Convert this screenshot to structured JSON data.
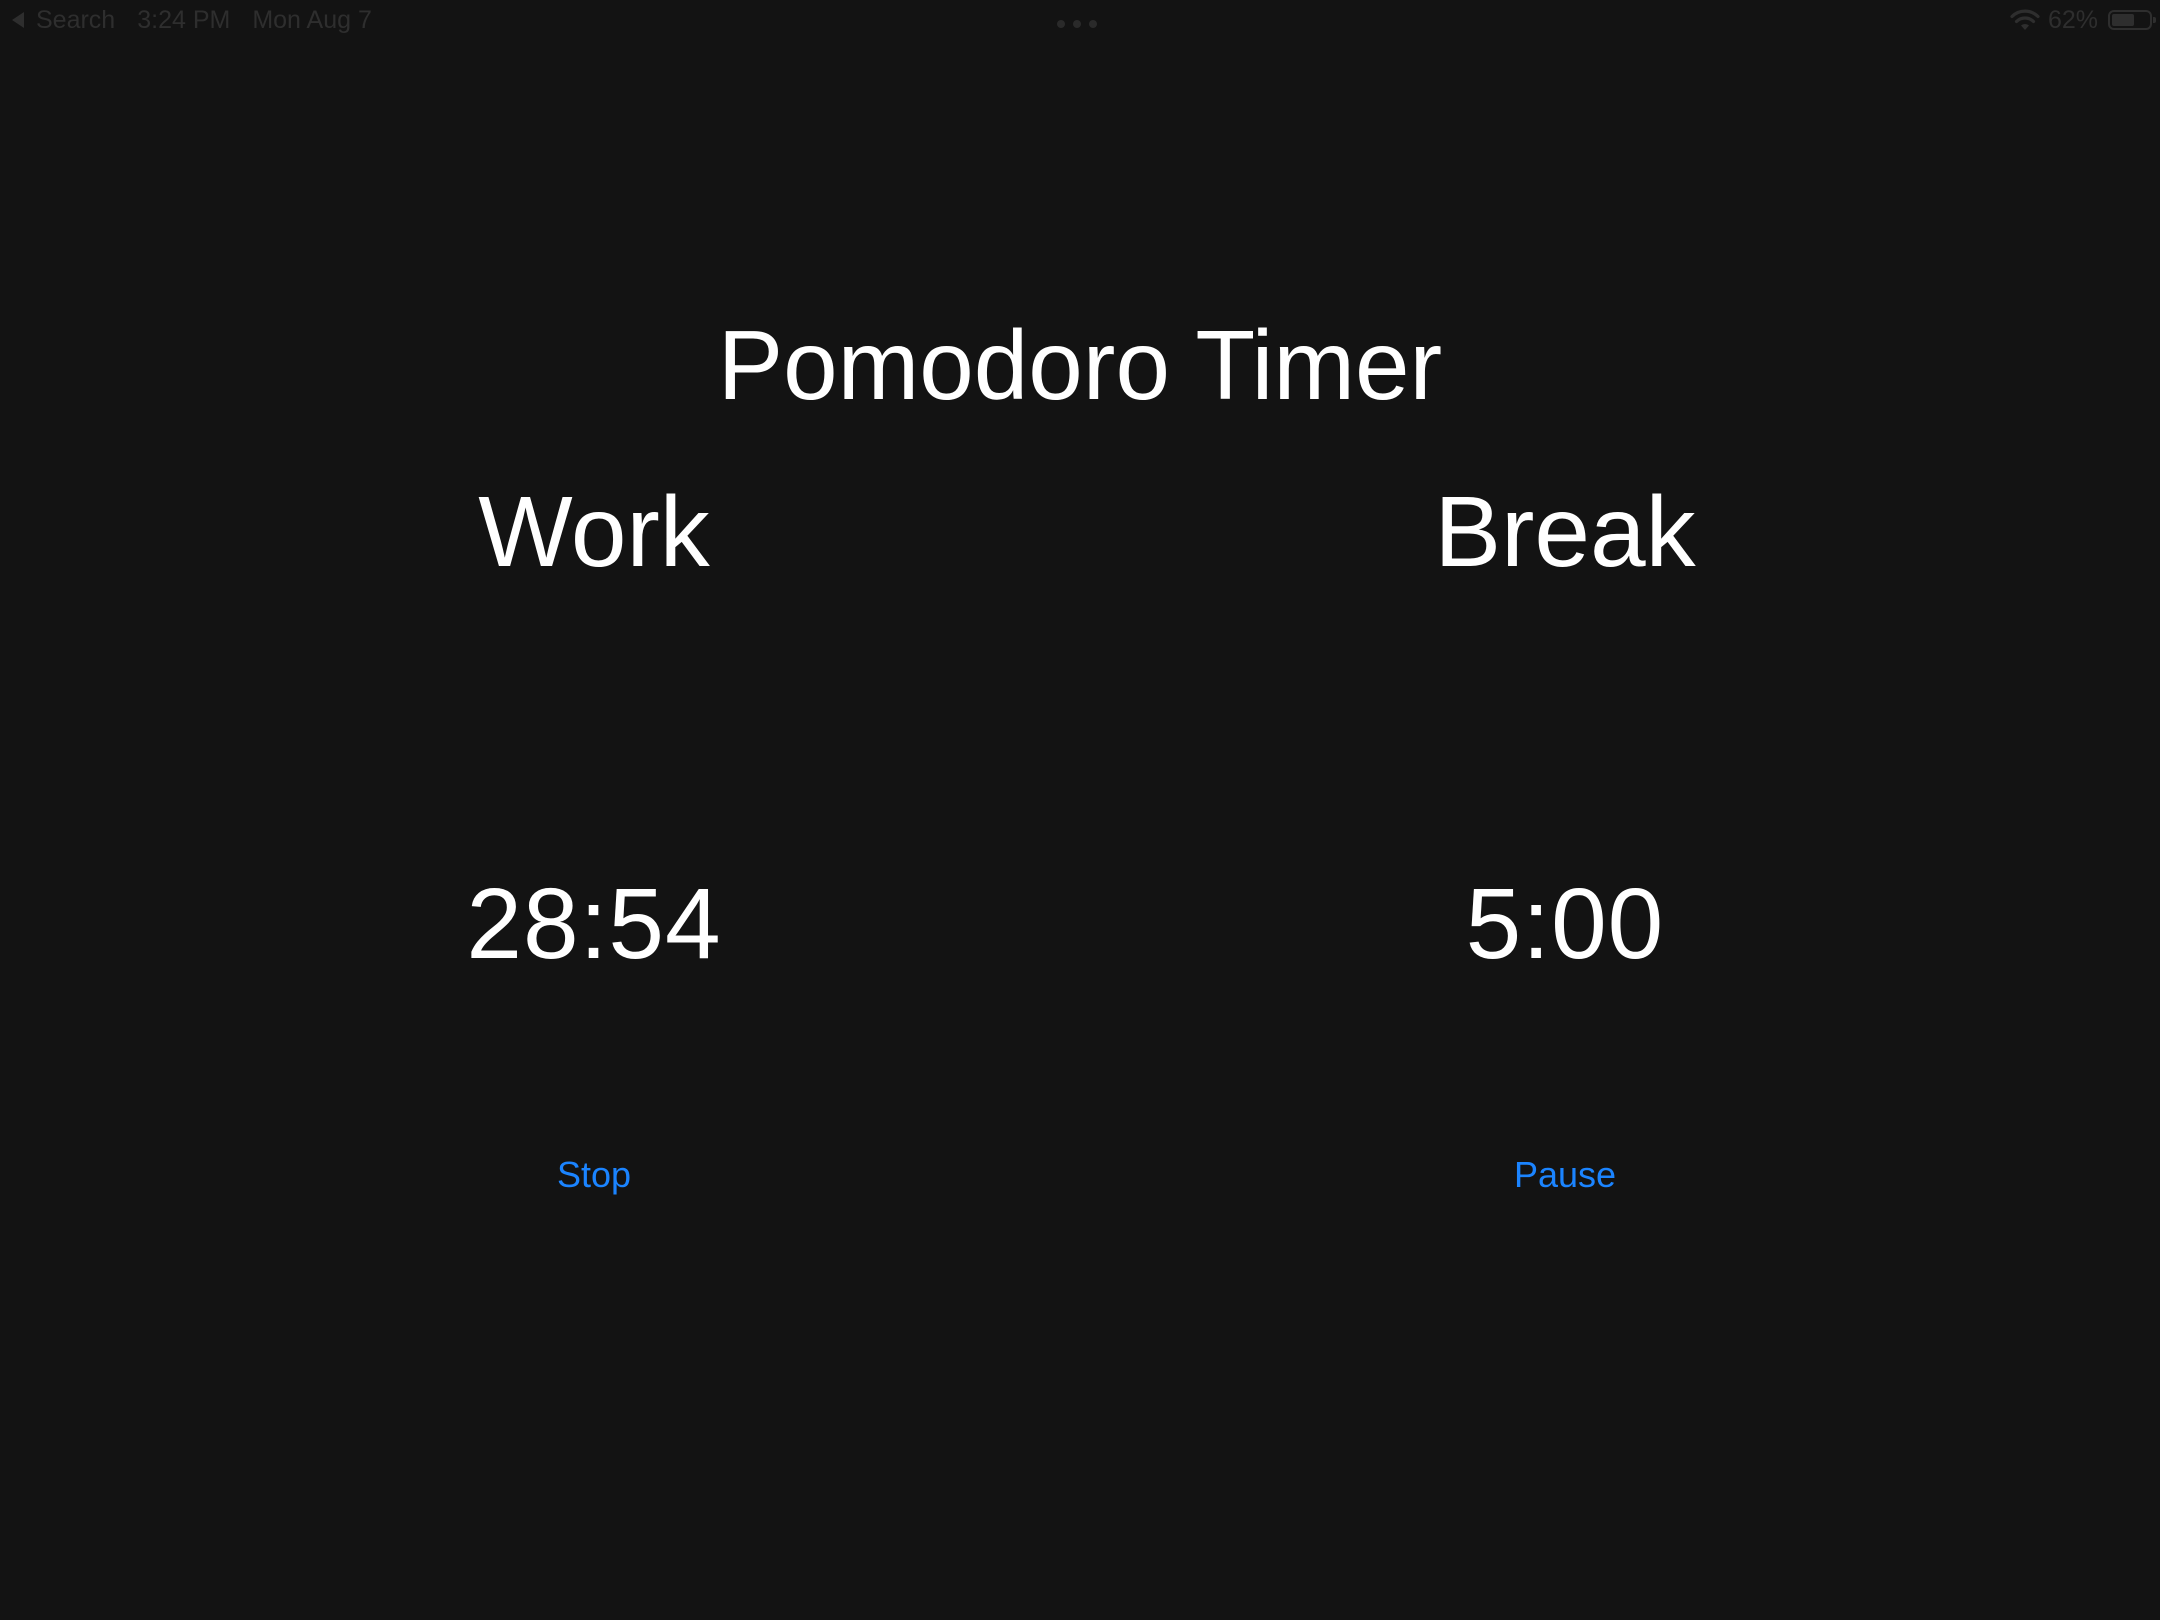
{
  "status_bar": {
    "back_label": "Search",
    "time": "3:24 PM",
    "date": "Mon Aug 7",
    "battery_percent": "62%",
    "battery_level": 0.62,
    "color": "#2e2e2e"
  },
  "app": {
    "title": "Pomodoro Timer",
    "background": "#131313",
    "accent": "#1b84ff"
  },
  "work": {
    "label": "Work",
    "time": "28:54",
    "button_label": "Stop"
  },
  "break": {
    "label": "Break",
    "time": "5:00",
    "button_label": "Pause"
  }
}
